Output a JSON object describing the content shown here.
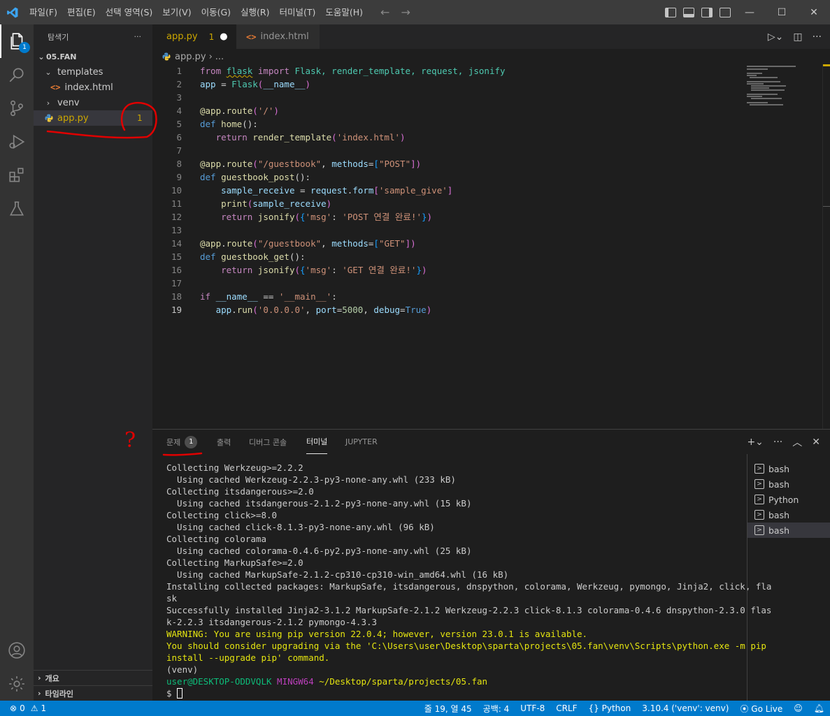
{
  "titlebar": {
    "menu": [
      "파일(F)",
      "편집(E)",
      "선택 영역(S)",
      "보기(V)",
      "이동(G)",
      "실행(R)",
      "터미널(T)",
      "도움말(H)"
    ],
    "nav_back": "←",
    "nav_forward": "→",
    "minimize": "—",
    "maximize": "☐",
    "close": "✕"
  },
  "activitybar": {
    "explorer_badge": "1"
  },
  "sidebar": {
    "title": "탐색기",
    "more": "···",
    "root": "05.FAN",
    "items": [
      {
        "label": "templates"
      },
      {
        "label": "index.html"
      },
      {
        "label": "venv"
      },
      {
        "label": "app.py",
        "problems": "1"
      }
    ],
    "outline": "개요",
    "timeline": "타임라인"
  },
  "tabs": [
    {
      "label": "app.py",
      "problems": "1",
      "dirty": "●"
    },
    {
      "label": "index.html"
    }
  ],
  "breadcrumb": {
    "file": "app.py",
    "sep": "›",
    "more": "..."
  },
  "editor": {
    "lines": [
      {
        "n": "1"
      },
      {
        "n": "2"
      },
      {
        "n": "3"
      },
      {
        "n": "4"
      },
      {
        "n": "5"
      },
      {
        "n": "6"
      },
      {
        "n": "7"
      },
      {
        "n": "8"
      },
      {
        "n": "9"
      },
      {
        "n": "10"
      },
      {
        "n": "11"
      },
      {
        "n": "12"
      },
      {
        "n": "13"
      },
      {
        "n": "14"
      },
      {
        "n": "15"
      },
      {
        "n": "16"
      },
      {
        "n": "17"
      },
      {
        "n": "18"
      },
      {
        "n": "19"
      }
    ],
    "code": {
      "l1": [
        "from",
        "flask",
        "import",
        "Flask, render_template, request, jsonify"
      ],
      "l2": [
        "app",
        " = ",
        "Flask",
        "(",
        "__name__",
        ")"
      ],
      "l4": [
        "@",
        "app",
        ".",
        "route",
        "(",
        "'/'",
        ")"
      ],
      "l5": [
        "def",
        "home",
        "():"
      ],
      "l6": [
        "return",
        "render_template",
        "(",
        "'index.html'",
        ")"
      ],
      "l8": [
        "@",
        "app",
        ".",
        "route",
        "(",
        "\"/guestbook\"",
        ", ",
        "methods",
        "=",
        "[",
        "\"POST\"",
        "])"
      ],
      "l9": [
        "def",
        "guestbook_post",
        "():"
      ],
      "l10": [
        "sample_receive",
        " = ",
        "request",
        ".",
        "form",
        "[",
        "'sample_give'",
        "]"
      ],
      "l11": [
        "print",
        "(",
        "sample_receive",
        ")"
      ],
      "l12": [
        "return",
        "jsonify",
        "(",
        "{",
        "'msg'",
        ": ",
        "'POST 연결 완료!'",
        "}",
        ")"
      ],
      "l14": [
        "@",
        "app",
        ".",
        "route",
        "(",
        "\"/guestbook\"",
        ", ",
        "methods",
        "=",
        "[",
        "\"GET\"",
        "])"
      ],
      "l15": [
        "def",
        "guestbook_get",
        "():"
      ],
      "l16": [
        "return",
        "jsonify",
        "(",
        "{",
        "'msg'",
        ": ",
        "'GET 연결 완료!'",
        "}",
        ")"
      ],
      "l18": [
        "if",
        "__name__",
        " == ",
        "'__main__'",
        ":"
      ],
      "l19": [
        "app",
        ".",
        "run",
        "(",
        "'0.0.0.0'",
        ", ",
        "port",
        "=",
        "5000",
        ", ",
        "debug",
        "=",
        "True",
        ")"
      ]
    }
  },
  "panel": {
    "tabs": [
      {
        "label": "문제",
        "count": "1"
      },
      {
        "label": "출력"
      },
      {
        "label": "디버그 콘솔"
      },
      {
        "label": "터미널"
      },
      {
        "label": "JUPYTER"
      }
    ],
    "terminal_lines": [
      "Collecting Werkzeug>=2.2.2",
      "  Using cached Werkzeug-2.2.3-py3-none-any.whl (233 kB)",
      "Collecting itsdangerous>=2.0",
      "  Using cached itsdangerous-2.1.2-py3-none-any.whl (15 kB)",
      "Collecting click>=8.0",
      "  Using cached click-8.1.3-py3-none-any.whl (96 kB)",
      "Collecting colorama",
      "  Using cached colorama-0.4.6-py2.py3-none-any.whl (25 kB)",
      "Collecting MarkupSafe>=2.0",
      "  Using cached MarkupSafe-2.1.2-cp310-cp310-win_amd64.whl (16 kB)",
      "Installing collected packages: MarkupSafe, itsdangerous, dnspython, colorama, Werkzeug, pymongo, Jinja2, click, fla",
      "sk",
      "Successfully installed Jinja2-3.1.2 MarkupSafe-2.1.2 Werkzeug-2.2.3 click-8.1.3 colorama-0.4.6 dnspython-2.3.0 flas",
      "k-2.2.3 itsdangerous-2.1.2 pymongo-4.3.3"
    ],
    "warning_lines": [
      "WARNING: You are using pip version 22.0.4; however, version 23.0.1 is available.",
      "You should consider upgrading via the 'C:\\Users\\user\\Desktop\\sparta\\projects\\05.fan\\venv\\Scripts\\python.exe -m pip",
      "install --upgrade pip' command."
    ],
    "venv_line": "(venv)",
    "prompt_user": "user@DESKTOP-ODDVQLK",
    "prompt_shell": "MINGW64",
    "prompt_path": "~/Desktop/sparta/projects/05.fan",
    "prompt_symbol": "$",
    "terminals": [
      "bash",
      "bash",
      "Python",
      "bash",
      "bash"
    ]
  },
  "statusbar": {
    "errors": "0",
    "warnings": "1",
    "position": "줄 19, 열 45",
    "spaces": "공백: 4",
    "encoding": "UTF-8",
    "eol": "CRLF",
    "language": "Python",
    "interpreter": "3.10.4 ('venv': venv)",
    "golive": "Go Live"
  },
  "annotations": {
    "question_mark": "?"
  },
  "colors": {
    "accent": "#007acc",
    "warning": "#cca700",
    "annotation": "#e00000"
  }
}
